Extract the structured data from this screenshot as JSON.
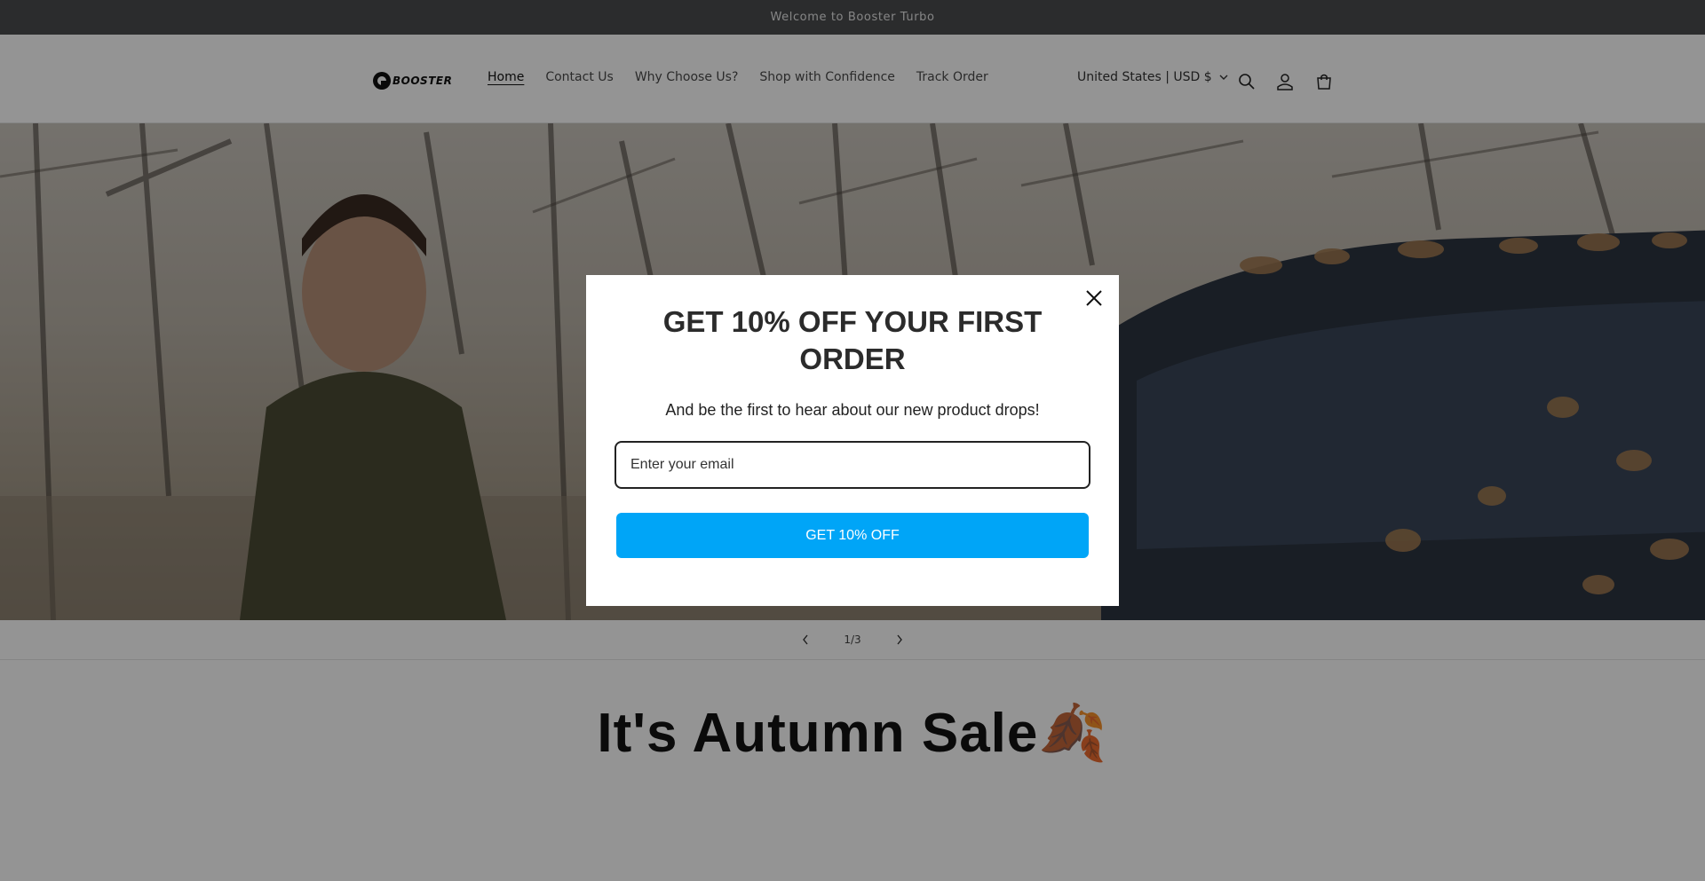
{
  "announcement": {
    "text": "Welcome to Booster Turbo"
  },
  "header": {
    "logo_text": "BOOSTER",
    "nav": [
      {
        "label": "Home",
        "active": true
      },
      {
        "label": "Contact Us",
        "active": false
      },
      {
        "label": "Why Choose Us?",
        "active": false
      },
      {
        "label": "Shop with Confidence",
        "active": false
      },
      {
        "label": "Track Order",
        "active": false
      }
    ],
    "locale": "United States | USD $",
    "icons": [
      "search-icon",
      "account-icon",
      "cart-icon"
    ]
  },
  "slider": {
    "counter": "1/3"
  },
  "section": {
    "title": "It's Autumn Sale🍂"
  },
  "popup": {
    "title": "GET 10% OFF YOUR FIRST ORDER",
    "subtitle": "And be the first to hear about our new product drops!",
    "email_placeholder": "Enter your email",
    "cta_label": "GET 10% OFF",
    "cta_color": "#00a5f7"
  }
}
